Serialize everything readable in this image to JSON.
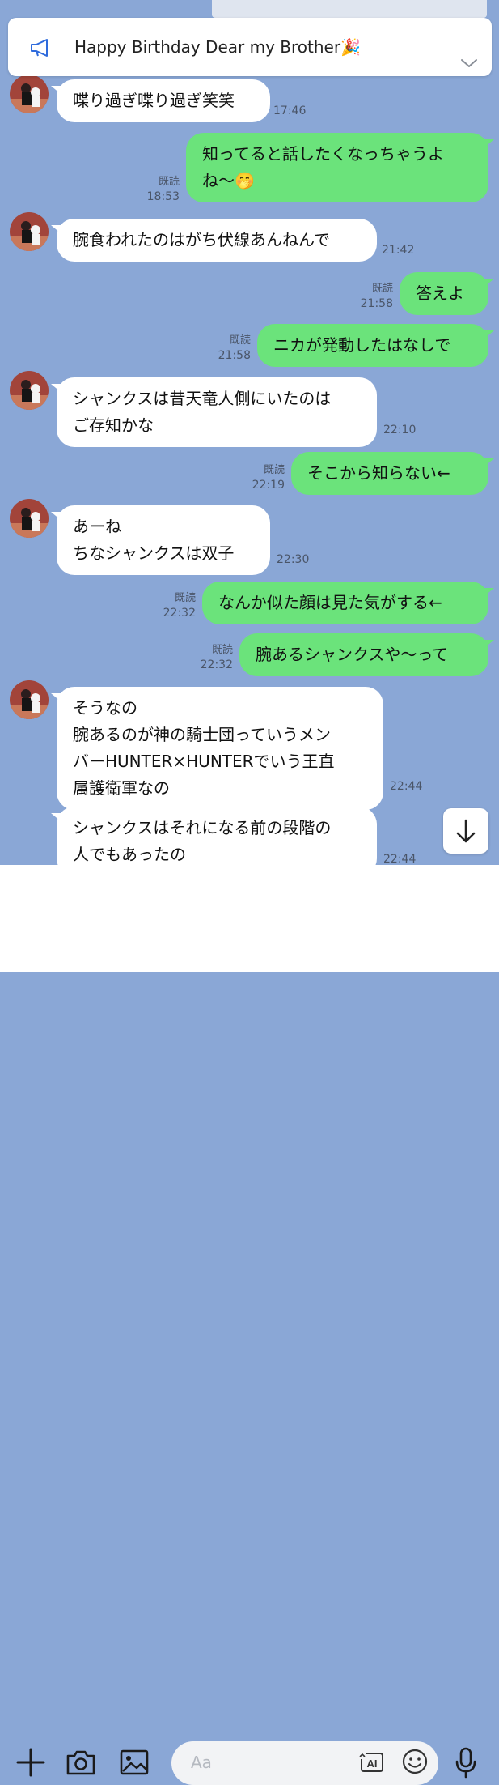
{
  "announcement": {
    "text": "Happy Birthday Dear my Brother🎉"
  },
  "messages": [
    {
      "side": "in",
      "lines": [
        "喋り過ぎ喋り過ぎ笑笑"
      ],
      "time": "17:46"
    },
    {
      "side": "out",
      "lines": [
        "知ってると話したくなっちゃうよ",
        "ね〜🤭"
      ],
      "read": "既読",
      "time": "18:53"
    },
    {
      "side": "in",
      "lines": [
        "腕食われたのはがち伏線あんねんで"
      ],
      "time": "21:42"
    },
    {
      "side": "out",
      "lines": [
        "答えよ"
      ],
      "read": "既読",
      "time": "21:58"
    },
    {
      "side": "out",
      "lines": [
        "ニカが発動したはなしで"
      ],
      "read": "既読",
      "time": "21:58"
    },
    {
      "side": "in",
      "lines": [
        "シャンクスは昔天竜人側にいたのは",
        "ご存知かな"
      ],
      "time": "22:10"
    },
    {
      "side": "out",
      "lines": [
        "そこから知らない←"
      ],
      "read": "既読",
      "time": "22:19"
    },
    {
      "side": "in",
      "lines": [
        "あーね",
        "ちなシャンクスは双子"
      ],
      "time": "22:30"
    },
    {
      "side": "out",
      "lines": [
        "なんか似た顔は見た気がする←"
      ],
      "read": "既読",
      "time": "22:32"
    },
    {
      "side": "out",
      "lines": [
        "腕あるシャンクスや〜って"
      ],
      "read": "既読",
      "time": "22:32"
    },
    {
      "side": "in",
      "lines": [
        "そうなの",
        "腕あるのが神の騎士団っていうメン",
        "バーHUNTER×HUNTERでいう王直",
        "属護衛軍なの"
      ],
      "time": "22:44"
    },
    {
      "side": "in",
      "lines": [
        "シャンクスはそれになる前の段階の",
        "人でもあったの"
      ],
      "time": "22:44"
    }
  ],
  "input": {
    "placeholder": "Aa"
  },
  "toolbar": {
    "ai_label": "AI"
  },
  "colors": {
    "background": "#8aa7d6",
    "outgoing_bubble": "#6be37b",
    "incoming_bubble": "#ffffff"
  },
  "icons": [
    "megaphone-icon",
    "chevron-down-icon",
    "plus-icon",
    "camera-icon",
    "image-icon",
    "ai-icon",
    "emoji-icon",
    "microphone-icon",
    "arrow-down-icon"
  ]
}
